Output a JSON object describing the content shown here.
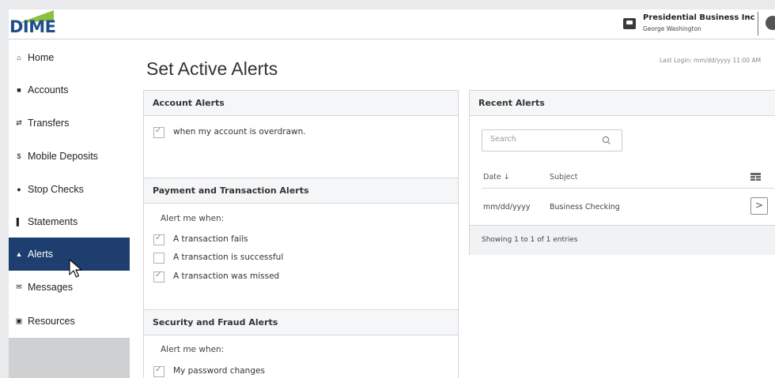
{
  "brand": {
    "logo_text": "DIME",
    "accent_color": "#1d4e89",
    "swoosh_color": "#8cbf3f"
  },
  "header": {
    "business_name": "Presidential Business Inc",
    "caret": "⌄",
    "user_name": "George Washington",
    "business_icon": "id-card-icon"
  },
  "sidebar": {
    "active_color": "#1d3e6e",
    "items": [
      {
        "icon": "home-icon",
        "glyph": "⌂",
        "label": "Home"
      },
      {
        "icon": "accounts-icon",
        "glyph": "■",
        "label": "Accounts"
      },
      {
        "icon": "transfers-icon",
        "glyph": "⇄",
        "label": "Transfers"
      },
      {
        "icon": "dollar-icon",
        "glyph": "$",
        "label": "Mobile Deposits"
      },
      {
        "icon": "stop-icon",
        "glyph": "●",
        "label": "Stop Checks"
      },
      {
        "icon": "statements-icon",
        "glyph": "▌",
        "label": "Statements"
      },
      {
        "icon": "alerts-icon",
        "glyph": "▲",
        "label": "Alerts",
        "active": true
      },
      {
        "icon": "messages-icon",
        "glyph": "✉",
        "label": "Messages"
      },
      {
        "icon": "resources-icon",
        "glyph": "▣",
        "label": "Resources"
      }
    ]
  },
  "page": {
    "title": "Set Active Alerts",
    "last_login": "Last Login: mm/dd/yyyy  11:00 AM"
  },
  "account_alerts": {
    "title": "Account Alerts",
    "items": [
      {
        "label": "when my account is overdrawn.",
        "checked": true
      }
    ]
  },
  "payment_alerts": {
    "title": "Payment and Transaction Alerts",
    "prompt": "Alert me when:",
    "items": [
      {
        "label": "A transaction fails",
        "checked": true
      },
      {
        "label": "A transaction is successful",
        "checked": false
      },
      {
        "label": "A transaction was missed",
        "checked": true
      }
    ]
  },
  "security_alerts": {
    "title": "Security and Fraud Alerts",
    "prompt": "Alert me when:",
    "items": [
      {
        "label": "My password changes",
        "checked": true
      }
    ]
  },
  "recent_alerts": {
    "title": "Recent Alerts",
    "search_placeholder": "Search",
    "columns": {
      "date": "Date ↓",
      "subject": "Subject"
    },
    "rows": [
      {
        "date": "mm/dd/yyyy",
        "subject": "Business Checking"
      }
    ],
    "row_action": ">",
    "footer": "Showing 1 to 1 of 1 entries"
  }
}
